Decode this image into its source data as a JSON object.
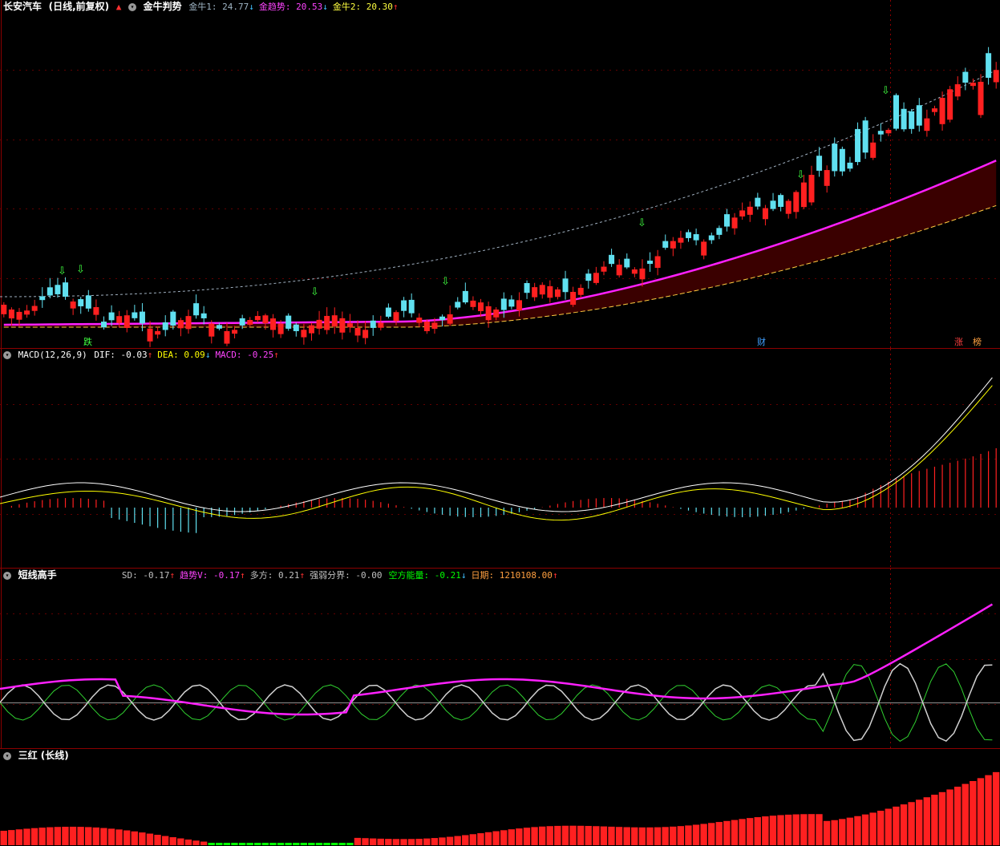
{
  "panel1": {
    "stock_name": "长安汽车",
    "period_label": "(日线,前复权)",
    "indicator_name": "金牛判势",
    "fields": [
      {
        "label": "金牛1:",
        "value": "24.77",
        "arrow": "↓",
        "color": "#9fb4c4"
      },
      {
        "label": "金趋势:",
        "value": "20.53",
        "arrow": "↓",
        "color": "#ff44ff"
      },
      {
        "label": "金牛2:",
        "value": "20.30",
        "arrow": "↑",
        "color": "#ffff40"
      }
    ],
    "event_tags": [
      "跌",
      "财",
      "涨",
      "榜"
    ]
  },
  "panel2": {
    "indicator_name": "MACD(12,26,9)",
    "fields": [
      {
        "label": "DIF:",
        "value": "-0.03",
        "arrow": "↑",
        "color": "#ffffff"
      },
      {
        "label": "DEA:",
        "value": "0.09",
        "arrow": "↓",
        "color": "#ffff00"
      },
      {
        "label": "MACD:",
        "value": "-0.25",
        "arrow": "↑",
        "color": "#ff44ff"
      }
    ]
  },
  "panel3": {
    "indicator_name": "短线高手",
    "fields": [
      {
        "label": "SD:",
        "value": "-0.17",
        "arrow": "↑",
        "color": "#c0c0c0"
      },
      {
        "label": "趋势V:",
        "value": "-0.17",
        "arrow": "↑",
        "color": "#ff44ff"
      },
      {
        "label": "多方:",
        "value": "0.21",
        "arrow": "↑",
        "color": "#c0c0c0"
      },
      {
        "label": "强弱分界:",
        "value": "-0.00",
        "arrow": "",
        "color": "#c0c0c0"
      },
      {
        "label": "空方能量:",
        "value": "-0.21",
        "arrow": "↓",
        "color": "#00ff00"
      },
      {
        "label": "日期:",
        "value": "1210108.00",
        "arrow": "↑",
        "color": "#ffa040"
      }
    ]
  },
  "panel4": {
    "indicator_name": "三红 (长线)"
  },
  "colors": {
    "background": "#000000",
    "up": "#ff2020",
    "down": "#60e0f0",
    "trend": "#ff20ff",
    "panel_border": "#8b0000",
    "macd_dif": "#ffffff",
    "macd_dea": "#ffff00",
    "green_bar": "#00ff00"
  },
  "icons": [
    "gear-icon",
    "red-up-arrow-icon",
    "green-down-arrow-icon"
  ]
}
